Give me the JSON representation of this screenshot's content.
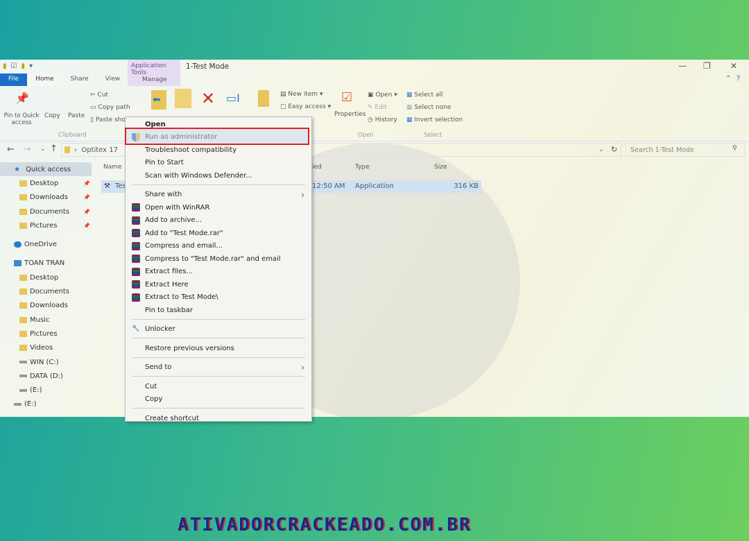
{
  "window": {
    "title": "1-Test Mode",
    "context_tab": "Application Tools",
    "context_sub": "Manage"
  },
  "tabs": [
    "File",
    "Home",
    "Share",
    "View"
  ],
  "ribbon": {
    "pin": "Pin to Quick access",
    "copy": "Copy",
    "paste": "Paste",
    "cut": "Cut",
    "copy_path": "Copy path",
    "paste_shortcut": "Paste sho",
    "new_item": "New item ▾",
    "easy_access": "Easy access ▾",
    "properties": "Properties",
    "open": "Open ▾",
    "edit": "Edit",
    "history": "History",
    "select_all": "Select all",
    "select_none": "Select none",
    "invert": "Invert selection",
    "groups": {
      "clipboard": "Clipboard",
      "open": "Open",
      "select": "Select"
    }
  },
  "address": {
    "crumb": "Optitex 17",
    "search_placeholder": "Search 1-Test Mode"
  },
  "nav": [
    {
      "label": "Quick access",
      "icon": "star-icon",
      "selected": true,
      "indent": 0
    },
    {
      "label": "Desktop",
      "pinned": true,
      "indent": 1
    },
    {
      "label": "Downloads",
      "pinned": true,
      "indent": 1
    },
    {
      "label": "Documents",
      "pinned": true,
      "indent": 1
    },
    {
      "label": "Pictures",
      "pinned": true,
      "indent": 1
    },
    {
      "label": "OneDrive",
      "icon": "cloud-icon",
      "indent": 0
    },
    {
      "label": "TOAN TRAN",
      "icon": "computer-icon",
      "indent": 0
    },
    {
      "label": "Desktop",
      "indent": 1
    },
    {
      "label": "Documents",
      "indent": 1
    },
    {
      "label": "Downloads",
      "indent": 1
    },
    {
      "label": "Music",
      "indent": 1
    },
    {
      "label": "Pictures",
      "indent": 1
    },
    {
      "label": "Videos",
      "indent": 1
    },
    {
      "label": "WIN (C:)",
      "icon": "drive-icon",
      "indent": 1
    },
    {
      "label": "DATA (D:)",
      "icon": "drive-icon",
      "indent": 1
    },
    {
      "label": "(E:)",
      "icon": "drive-icon",
      "indent": 1
    },
    {
      "label": "(E:)",
      "icon": "drive-icon",
      "indent": 0
    }
  ],
  "columns": {
    "name": "Name",
    "modified": "ied",
    "type": "Type",
    "size": "Size"
  },
  "file": {
    "name": "Tes",
    "modified": "12:50 AM",
    "type": "Application",
    "size": "316 KB"
  },
  "menu": [
    {
      "label": "Open",
      "bold": true
    },
    {
      "label": "Run as administrator",
      "icon": "shield-icon",
      "highlighted": true
    },
    {
      "label": "Troubleshoot compatibility"
    },
    {
      "label": "Pin to Start"
    },
    {
      "label": "Scan with Windows Defender..."
    },
    {
      "sep": true
    },
    {
      "label": "Share with",
      "submenu": true
    },
    {
      "label": "Open with WinRAR",
      "icon": "winrar-icon"
    },
    {
      "label": "Add to archive...",
      "icon": "winrar-icon"
    },
    {
      "label": "Add to \"Test Mode.rar\"",
      "icon": "winrar-icon"
    },
    {
      "label": "Compress and email...",
      "icon": "winrar-icon"
    },
    {
      "label": "Compress to \"Test Mode.rar\" and email",
      "icon": "winrar-icon"
    },
    {
      "label": "Extract files...",
      "icon": "winrar-icon"
    },
    {
      "label": "Extract Here",
      "icon": "winrar-icon"
    },
    {
      "label": "Extract to Test Mode\\",
      "icon": "winrar-icon"
    },
    {
      "label": "Pin to taskbar"
    },
    {
      "sep": true
    },
    {
      "label": "Unlocker",
      "icon": "unlocker-icon"
    },
    {
      "sep": true
    },
    {
      "label": "Restore previous versions"
    },
    {
      "sep": true
    },
    {
      "label": "Send to",
      "submenu": true
    },
    {
      "sep": true
    },
    {
      "label": "Cut"
    },
    {
      "label": "Copy"
    },
    {
      "sep": true
    },
    {
      "label": "Create shortcut"
    }
  ],
  "watermark": "ATIVADORCRACKEADO.COM.BR",
  "colors": {
    "highlight_border": "#dd2222",
    "file_tab": "#1a6fc7"
  }
}
